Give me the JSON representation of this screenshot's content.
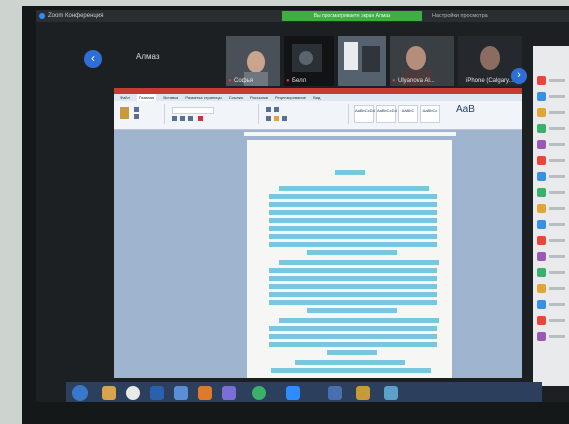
{
  "window": {
    "title": "Zoom Конференция"
  },
  "share_banner": "Вы просматриваете экран Алмаз",
  "settings_label": "Настройки просмотра",
  "host_name": "Алмаз",
  "participants": [
    {
      "name": "Софья"
    },
    {
      "name": "Белл"
    },
    {
      "name": "Ulyanova Al..."
    },
    {
      "name": "iPhone (Calgary..."
    }
  ],
  "word": {
    "tabs": [
      "Файл",
      "Главная",
      "Вставка",
      "Разметка страницы",
      "Ссылки",
      "Рассылки",
      "Рецензирование",
      "Вид"
    ],
    "active_tab": "Главная",
    "styles": [
      "AaBbCcDd",
      "AaBbCcDd",
      "AaBbC",
      "AaBbCc"
    ],
    "aab": "AaB"
  },
  "colors": {
    "accent": "#2d6fd6",
    "share_green": "#3fae42",
    "highlight": "#79c7dc",
    "word_red": "#c53a34"
  }
}
